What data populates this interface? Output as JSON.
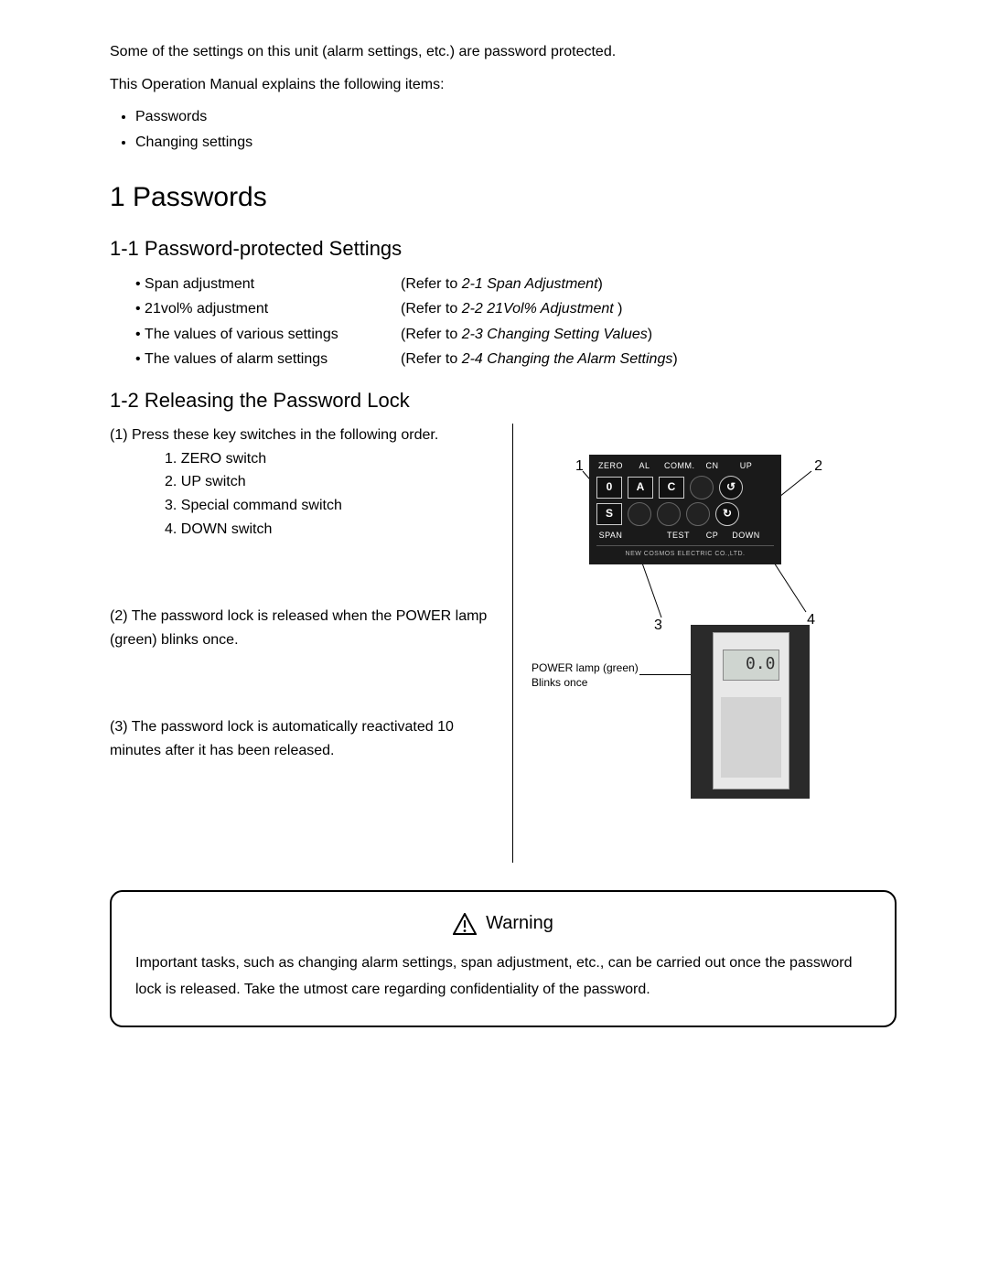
{
  "intro": {
    "line1": "Some of the settings on this unit (alarm settings, etc.) are password protected.",
    "line2": "This Operation Manual explains the following items:",
    "bullets": [
      "Passwords",
      "Changing settings"
    ]
  },
  "section1": {
    "heading": "1 Passwords",
    "sub1": {
      "heading": "1-1 Password-protected Settings",
      "items": [
        {
          "name": "Span adjustment",
          "refer_prefix": "(Refer to ",
          "refer_italic": "2-1 Span Adjustment",
          "refer_suffix": ")"
        },
        {
          "name": "21vol% adjustment",
          "refer_prefix": "(Refer to ",
          "refer_italic": "2-2 21Vol% Adjustment ",
          "refer_suffix": ")"
        },
        {
          "name": "The values of various settings",
          "refer_prefix": "(Refer to ",
          "refer_italic": "2-3 Changing Setting Values",
          "refer_suffix": ")"
        },
        {
          "name": "The values of alarm settings",
          "refer_prefix": "(Refer to ",
          "refer_italic": "2-4 Changing the Alarm Settings",
          "refer_suffix": ")"
        }
      ]
    },
    "sub2": {
      "heading": "1-2 Releasing the Password Lock",
      "step1_lead": "(1) Press these key switches in the following order.",
      "step1_items": [
        "1. ZERO switch",
        "2. UP switch",
        "3. Special command switch",
        "4. DOWN switch"
      ],
      "step2": "(2) The password lock is released when the POWER lamp (green) blinks once.",
      "step3": "(3) The password lock is automatically reactivated 10 minutes after it has been released."
    }
  },
  "panel": {
    "top_labels": [
      "ZERO",
      "AL",
      "COMM.",
      "CN",
      "UP"
    ],
    "bottom_labels": [
      "SPAN",
      "",
      "TEST",
      "CP",
      "DOWN"
    ],
    "keys_top": [
      "0",
      "A",
      "C",
      "",
      "↺"
    ],
    "keys_bot": [
      "S",
      "",
      "",
      "",
      "↻"
    ],
    "footer": "NEW COSMOS ELECTRIC CO.,LTD.",
    "callouts": {
      "c1": "1",
      "c2": "2",
      "c3": "3",
      "c4": "4"
    }
  },
  "photo": {
    "label_line1": "POWER lamp (green)",
    "label_line2": "Blinks once",
    "lcd": "0.0"
  },
  "warning": {
    "title": "Warning",
    "body": "Important tasks, such as changing alarm settings, span adjustment, etc., can be carried out once the password lock is released. Take the utmost care regarding confidentiality of the password."
  }
}
